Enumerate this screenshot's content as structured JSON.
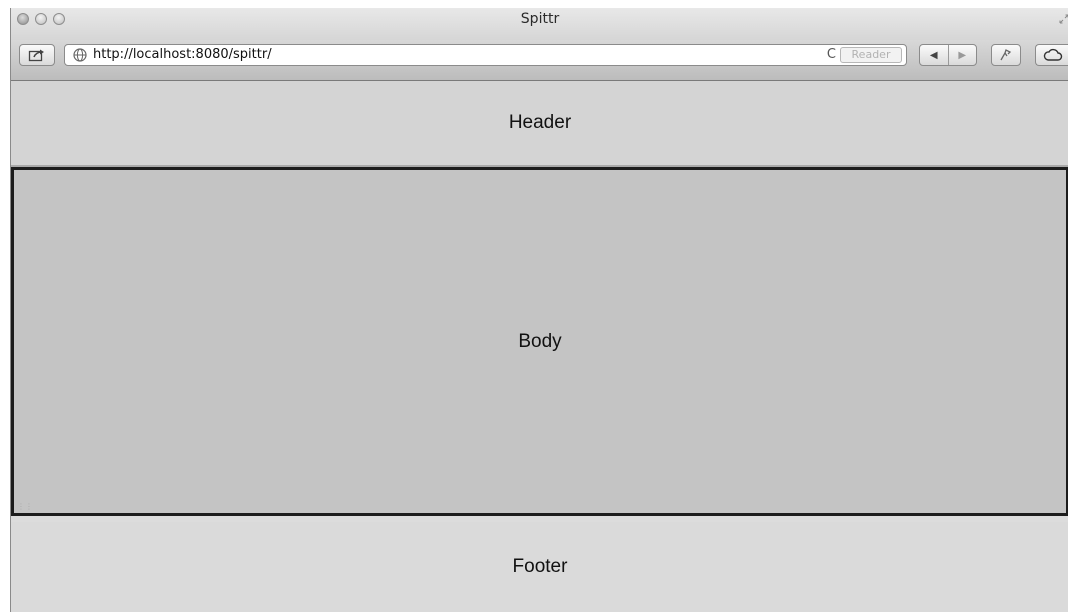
{
  "window": {
    "title": "Spittr"
  },
  "toolbar": {
    "url": "http://localhost:8080/spittr/",
    "reload_glyph": "C",
    "reader_label": "Reader",
    "back_glyph": "◀",
    "forward_glyph": "▶"
  },
  "page": {
    "header_label": "Header",
    "body_label": "Body",
    "footer_label": "Footer"
  }
}
